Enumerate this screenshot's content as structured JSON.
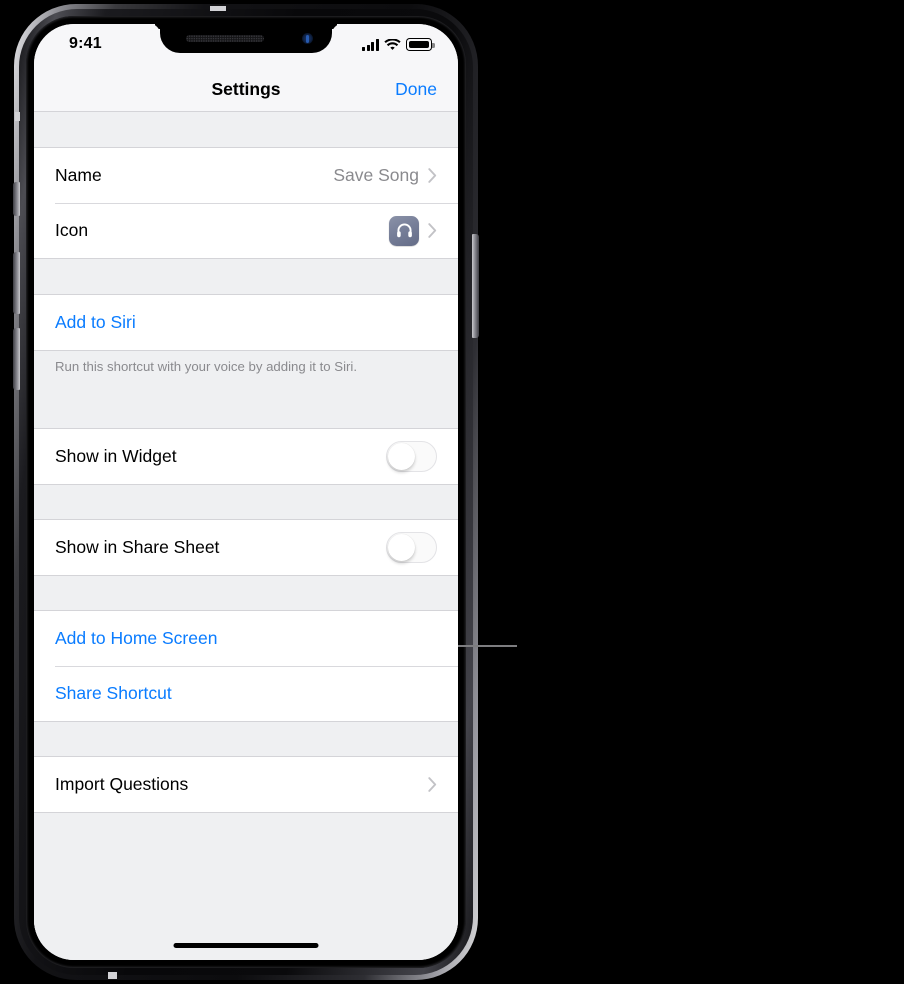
{
  "status_bar": {
    "time": "9:41",
    "signal_icon": "cellular-signal-icon",
    "signal_bars_filled": 4,
    "wifi_icon": "wifi-icon",
    "battery_icon": "battery-full-icon"
  },
  "nav_bar": {
    "title": "Settings",
    "done_label": "Done"
  },
  "colors": {
    "accent_blue": "#0a7cff",
    "secondary_text": "#8a8a8e",
    "group_background": "#eff0f2",
    "row_background": "#ffffff",
    "icon_swatch": "#777f99"
  },
  "groups": [
    {
      "rows": [
        {
          "label": "Name",
          "value": "Save Song",
          "accessory": "chevron",
          "style": "default"
        },
        {
          "label": "Icon",
          "value": "",
          "accessory": "icon-swatch-chevron",
          "style": "default",
          "icon": "headphones-icon"
        }
      ],
      "footer": ""
    },
    {
      "rows": [
        {
          "label": "Add to Siri",
          "value": "",
          "accessory": "none",
          "style": "link"
        }
      ],
      "footer": "Run this shortcut with your voice by adding it to Siri."
    },
    {
      "rows": [
        {
          "label": "Show in Widget",
          "value": "off",
          "accessory": "toggle",
          "style": "default"
        }
      ],
      "footer": ""
    },
    {
      "rows": [
        {
          "label": "Show in Share Sheet",
          "value": "off",
          "accessory": "toggle",
          "style": "default"
        }
      ],
      "footer": ""
    },
    {
      "rows": [
        {
          "label": "Add to Home Screen",
          "value": "",
          "accessory": "none",
          "style": "link"
        },
        {
          "label": "Share Shortcut",
          "value": "",
          "accessory": "none",
          "style": "link"
        }
      ],
      "footer": ""
    },
    {
      "rows": [
        {
          "label": "Import Questions",
          "value": "",
          "accessory": "chevron",
          "style": "default"
        }
      ],
      "footer": ""
    }
  ],
  "home_indicator": "home-indicator",
  "callout": {
    "name": "callout-leader-line"
  }
}
